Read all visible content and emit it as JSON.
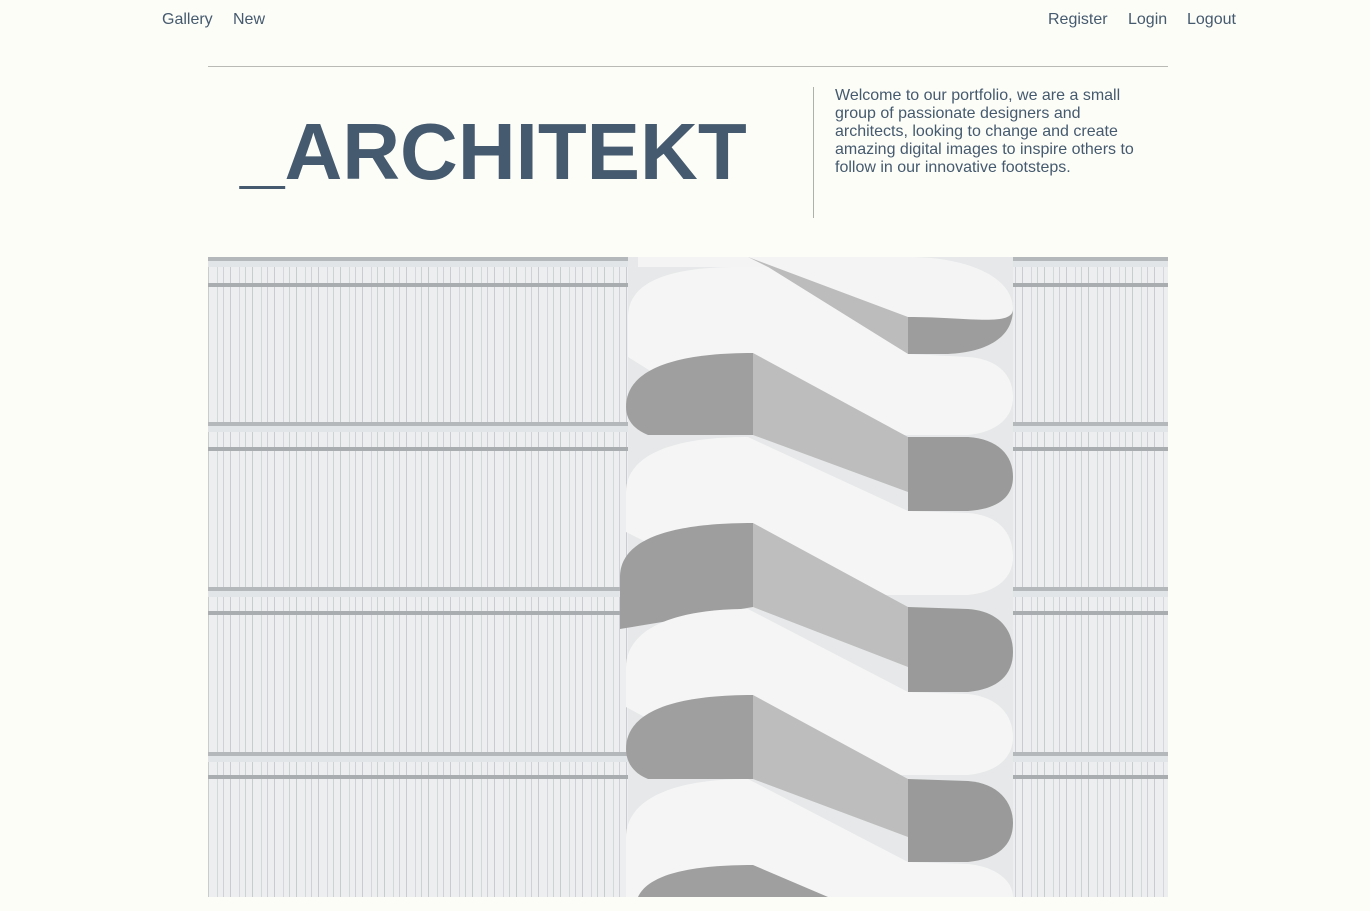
{
  "nav": {
    "left": [
      {
        "label": "Gallery"
      },
      {
        "label": "New"
      }
    ],
    "right": [
      {
        "label": "Register"
      },
      {
        "label": "Login"
      },
      {
        "label": "Logout"
      }
    ]
  },
  "header": {
    "brand": "_ARCHITEKT",
    "intro": "Welcome to our portfolio, we are a small group of passionate designers and architects, looking to change and create amazing digital images to inspire others to follow in our innovative footsteps."
  },
  "hero": {
    "subject": "white spiral staircase against facade"
  },
  "colors": {
    "background": "#fdfdf8",
    "text": "#455a6e",
    "rule": "#b9bab5"
  }
}
